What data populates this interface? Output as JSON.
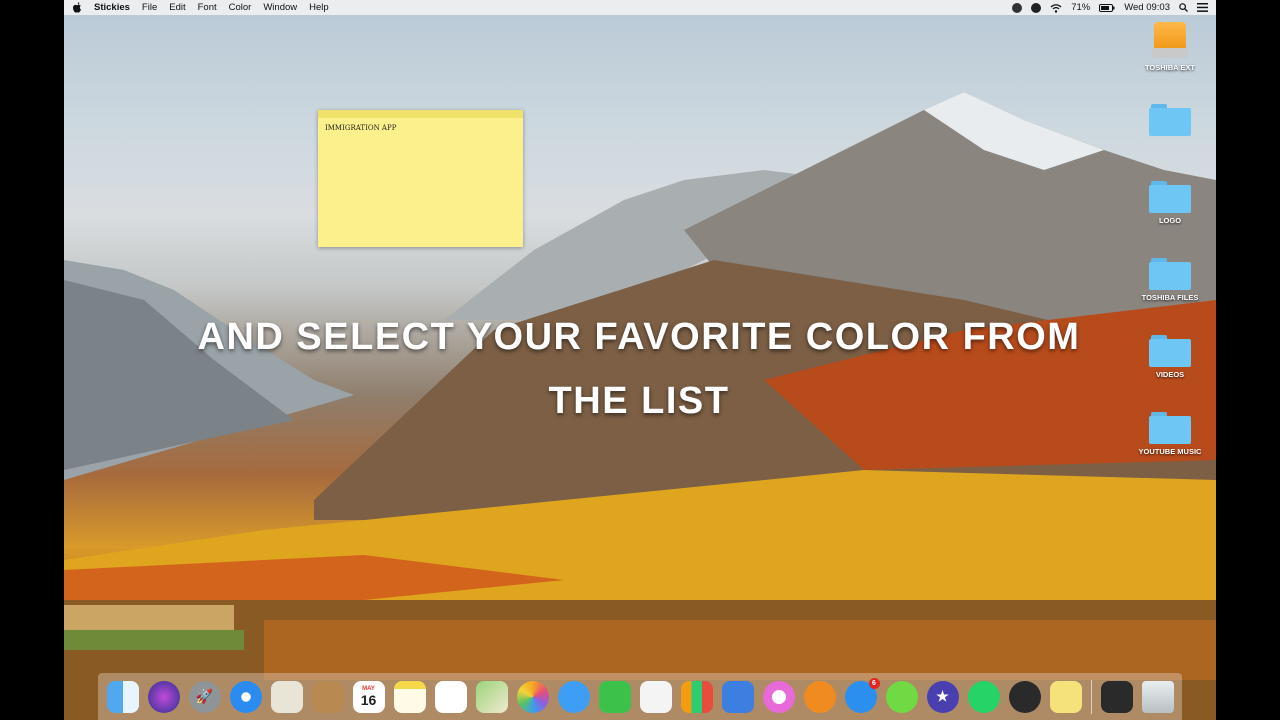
{
  "menubar": {
    "app_name": "Stickies",
    "menus": [
      "File",
      "Edit",
      "Font",
      "Color",
      "Window",
      "Help"
    ],
    "battery": "71%",
    "clock": "Wed 09:03"
  },
  "sticky": {
    "text": "IMMIGRATION APP"
  },
  "caption": {
    "line1": "AND SELECT YOUR FAVORITE COLOR FROM",
    "line2": "THE LIST"
  },
  "desktop_icons": [
    {
      "label": "TOSHIBA EXT",
      "kind": "drive-icon"
    },
    {
      "label": "",
      "kind": "folder-icon"
    },
    {
      "label": "LOGO",
      "kind": "folder-icon"
    },
    {
      "label": "TOSHIBA FILES",
      "kind": "folder-icon"
    },
    {
      "label": "VIDEOS",
      "kind": "folder-icon"
    },
    {
      "label": "YOUTUBE MUSIC",
      "kind": "folder-icon"
    }
  ],
  "dock": {
    "calendar": {
      "month": "MAY",
      "day": "16"
    },
    "app_store_badge": "6"
  }
}
